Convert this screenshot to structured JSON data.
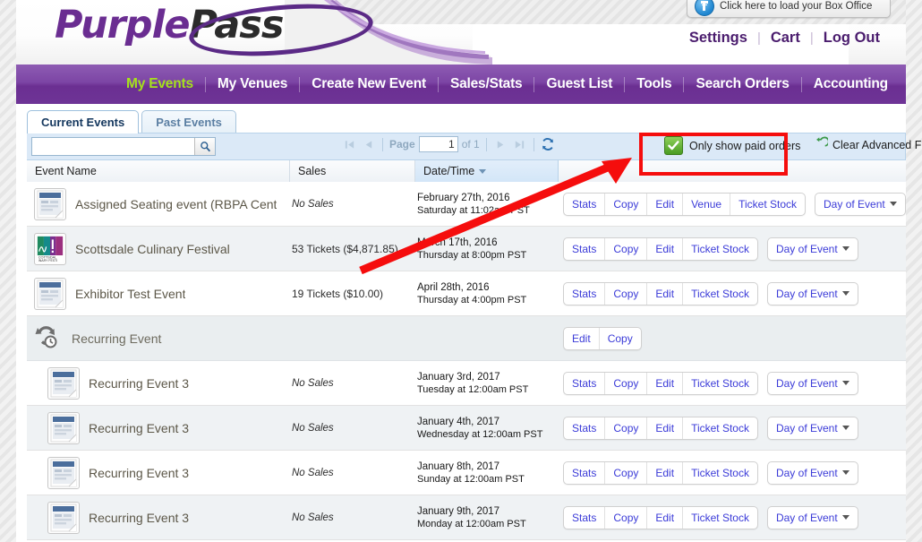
{
  "header": {
    "logo_purple": "Purple",
    "logo_dark": "Pass",
    "box_office_label": "Click here to load your Box Office",
    "box_office_icon": "user-circle-icon",
    "top_links": [
      {
        "label": "Settings"
      },
      {
        "label": "Cart"
      },
      {
        "label": "Log Out"
      }
    ],
    "separator": "|"
  },
  "nav": {
    "items": [
      {
        "label": "My Events",
        "active": true
      },
      {
        "label": "My Venues",
        "active": false
      },
      {
        "label": "Create New Event",
        "active": false
      },
      {
        "label": "Sales/Stats",
        "active": false
      },
      {
        "label": "Guest List",
        "active": false
      },
      {
        "label": "Tools",
        "active": false
      },
      {
        "label": "Search Orders",
        "active": false
      },
      {
        "label": "Accounting",
        "active": false
      }
    ],
    "active_color": "#a6e21c",
    "bar_color": "#6e3496"
  },
  "tabs": [
    {
      "label": "Current Events",
      "active": true
    },
    {
      "label": "Past Events",
      "active": false
    }
  ],
  "filterbar": {
    "search_value": "",
    "search_placeholder": "",
    "search_icon": "magnifier-icon",
    "pager": {
      "first_icon": "first-page-icon",
      "prev_icon": "previous-page-icon",
      "page_label": "Page",
      "page_value": "1",
      "of_label": "of 1",
      "next_icon": "next-page-icon",
      "last_icon": "last-page-icon",
      "refresh_icon": "refresh-icon"
    },
    "paid_orders": {
      "label": "Only show paid orders",
      "checked": true,
      "check_icon": "checkmark-icon",
      "check_color": "#4a9c23"
    },
    "clear_filters": {
      "label": "Clear Advanced Filters",
      "icon": "undo-arrow-icon"
    }
  },
  "table": {
    "columns": [
      {
        "label": "Event Name"
      },
      {
        "label": "Sales"
      },
      {
        "label": "Date/Time",
        "sorted": true,
        "sort_icon": "sort-descending-icon"
      }
    ],
    "rows": [
      {
        "type": "event",
        "name": "Assigned Seating event (RBPA Cent",
        "thumb": "ticket-thumbnail",
        "sales": "No Sales",
        "has_sales": false,
        "date": "February 27th, 2016",
        "time": "Saturday at 11:02am PST",
        "actions": [
          "Stats",
          "Copy",
          "Edit",
          "Venue",
          "Ticket Stock"
        ],
        "dropdown": "Day of Event",
        "alt": false,
        "indent": false
      },
      {
        "type": "event",
        "name": "Scottsdale Culinary Festival",
        "thumb": "scottsdale-logo",
        "sales": "53 Tickets ($4,871.85)",
        "has_sales": true,
        "date": "March 17th, 2016",
        "time": "Thursday at 8:00pm PST",
        "actions": [
          "Stats",
          "Copy",
          "Edit",
          "Ticket Stock"
        ],
        "dropdown": "Day of Event",
        "alt": true,
        "indent": false
      },
      {
        "type": "event",
        "name": "Exhibitor Test Event",
        "thumb": "ticket-thumbnail",
        "sales": "19 Tickets ($10.00)",
        "has_sales": true,
        "date": "April 28th, 2016",
        "time": "Thursday at 4:00pm PST",
        "actions": [
          "Stats",
          "Copy",
          "Edit",
          "Ticket Stock"
        ],
        "dropdown": "Day of Event",
        "alt": false,
        "indent": false
      },
      {
        "type": "recurring-header",
        "name": "Recurring Event",
        "thumb": "recurring-clock-icon",
        "sales": "",
        "has_sales": false,
        "date": "",
        "time": "",
        "actions": [
          "Edit",
          "Copy"
        ],
        "dropdown": "",
        "alt": false,
        "indent": false
      },
      {
        "type": "event",
        "name": "Recurring Event 3",
        "thumb": "ticket-thumbnail",
        "sales": "No Sales",
        "has_sales": false,
        "date": "January 3rd, 2017",
        "time": "Tuesday at 12:00am PST",
        "actions": [
          "Stats",
          "Copy",
          "Edit",
          "Ticket Stock"
        ],
        "dropdown": "Day of Event",
        "alt": false,
        "indent": true
      },
      {
        "type": "event",
        "name": "Recurring Event 3",
        "thumb": "ticket-thumbnail",
        "sales": "No Sales",
        "has_sales": false,
        "date": "January 4th, 2017",
        "time": "Wednesday at 12:00am PST",
        "actions": [
          "Stats",
          "Copy",
          "Edit",
          "Ticket Stock"
        ],
        "dropdown": "Day of Event",
        "alt": true,
        "indent": true
      },
      {
        "type": "event",
        "name": "Recurring Event 3",
        "thumb": "ticket-thumbnail",
        "sales": "No Sales",
        "has_sales": false,
        "date": "January 8th, 2017",
        "time": "Sunday at 12:00am PST",
        "actions": [
          "Stats",
          "Copy",
          "Edit",
          "Ticket Stock"
        ],
        "dropdown": "Day of Event",
        "alt": false,
        "indent": true
      },
      {
        "type": "event",
        "name": "Recurring Event 3",
        "thumb": "ticket-thumbnail",
        "sales": "No Sales",
        "has_sales": false,
        "date": "January 9th, 2017",
        "time": "Monday at 12:00am PST",
        "actions": [
          "Stats",
          "Copy",
          "Edit",
          "Ticket Stock"
        ],
        "dropdown": "Day of Event",
        "alt": true,
        "indent": true
      }
    ]
  },
  "annotations": {
    "highlight_color": "#f50d0d",
    "arrow": "red-arrow-pointing-to-paid-orders-filter",
    "box_target": "Only show paid orders"
  }
}
